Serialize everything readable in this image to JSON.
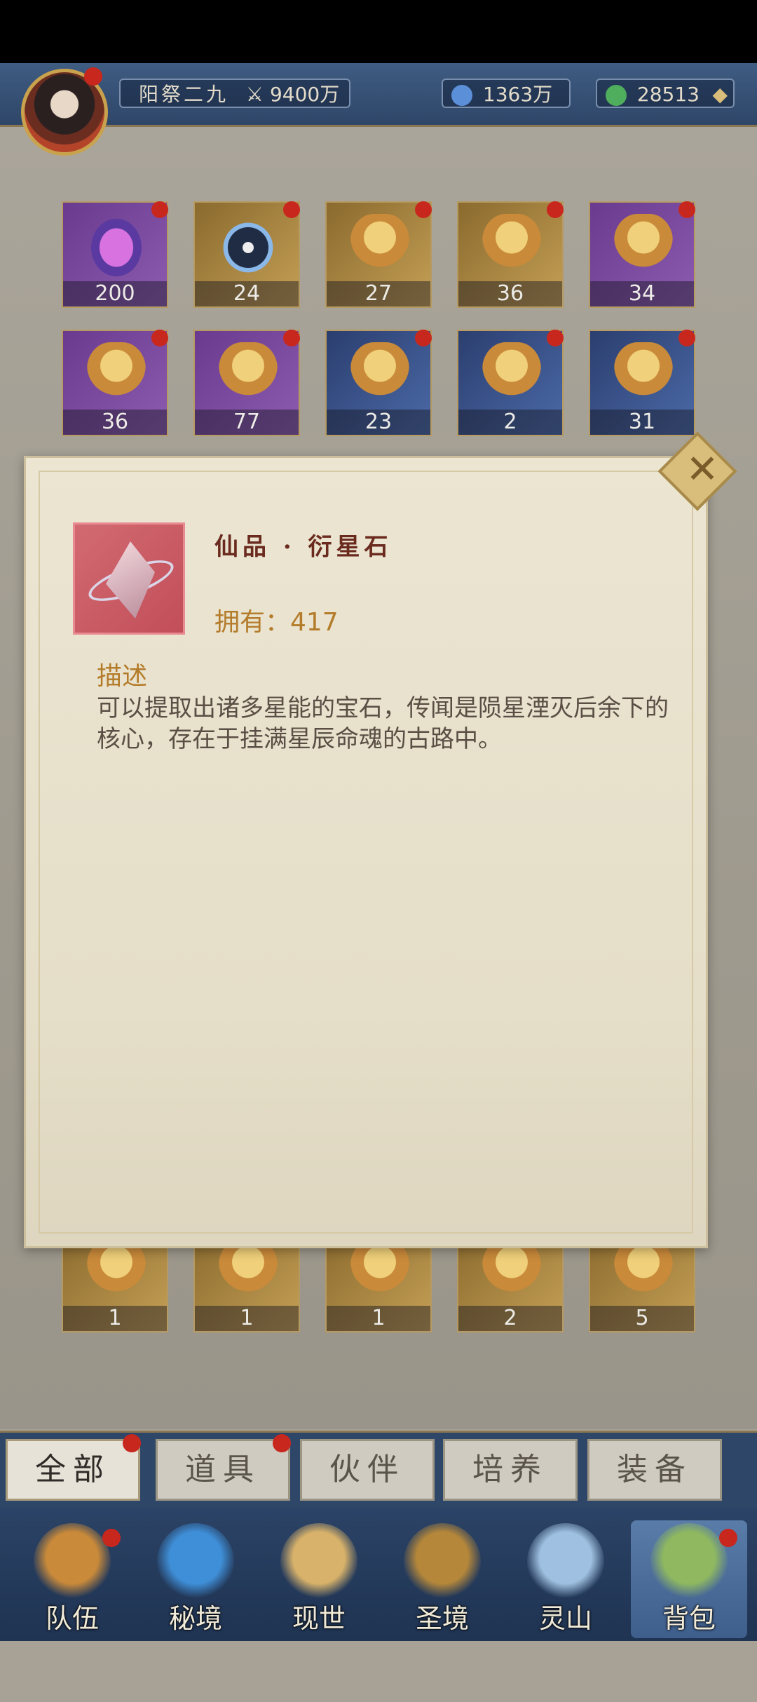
{
  "header": {
    "date_label": "阳祭二九",
    "power_value": "9400万",
    "currency_spirit": "1363万",
    "currency_jade": "28513"
  },
  "grid_top": [
    {
      "qty": "200",
      "rarity": "purple",
      "art": "gem"
    },
    {
      "qty": "24",
      "rarity": "gold",
      "art": "bagua"
    },
    {
      "qty": "27",
      "rarity": "gold",
      "art": "pouch"
    },
    {
      "qty": "36",
      "rarity": "gold",
      "art": "pouch"
    },
    {
      "qty": "34",
      "rarity": "purple",
      "art": "pouch"
    },
    {
      "qty": "36",
      "rarity": "purple",
      "art": "pouch"
    },
    {
      "qty": "77",
      "rarity": "purple",
      "art": "pouch"
    },
    {
      "qty": "23",
      "rarity": "blue",
      "art": "pouch"
    },
    {
      "qty": "2",
      "rarity": "blue",
      "art": "pouch"
    },
    {
      "qty": "31",
      "rarity": "blue",
      "art": "pouch"
    }
  ],
  "grid_bottom": [
    {
      "qty": "1",
      "rarity": "gold",
      "art": "scroll"
    },
    {
      "qty": "1",
      "rarity": "gold",
      "art": "jade"
    },
    {
      "qty": "1",
      "rarity": "gold",
      "art": "sword"
    },
    {
      "qty": "2",
      "rarity": "gold",
      "art": "robe"
    },
    {
      "qty": "5",
      "rarity": "gold",
      "art": "robe"
    }
  ],
  "modal": {
    "item_name": "仙品 · 衍星石",
    "owned_label": "拥有：417",
    "desc_title": "描述",
    "desc_text": "可以提取出诸多星能的宝石，传闻是陨星湮灭后余下的核心，存在于挂满星辰命魂的古路中。"
  },
  "tabs": [
    {
      "label": "全部",
      "active": true,
      "badge": true
    },
    {
      "label": "道具",
      "active": false,
      "badge": true
    },
    {
      "label": "伙伴",
      "active": false,
      "badge": false
    },
    {
      "label": "培养",
      "active": false,
      "badge": false
    },
    {
      "label": "装备",
      "active": false,
      "badge": false
    }
  ],
  "nav": [
    {
      "label": "队伍",
      "badge": true
    },
    {
      "label": "秘境",
      "badge": false
    },
    {
      "label": "现世",
      "badge": false
    },
    {
      "label": "圣境",
      "badge": false
    },
    {
      "label": "灵山",
      "badge": false
    },
    {
      "label": "背包",
      "badge": true,
      "active": true
    }
  ],
  "colors": {
    "accent_gold": "#b47c2a",
    "badge_red": "#c8271e",
    "nav_blue": "#2e4668"
  }
}
